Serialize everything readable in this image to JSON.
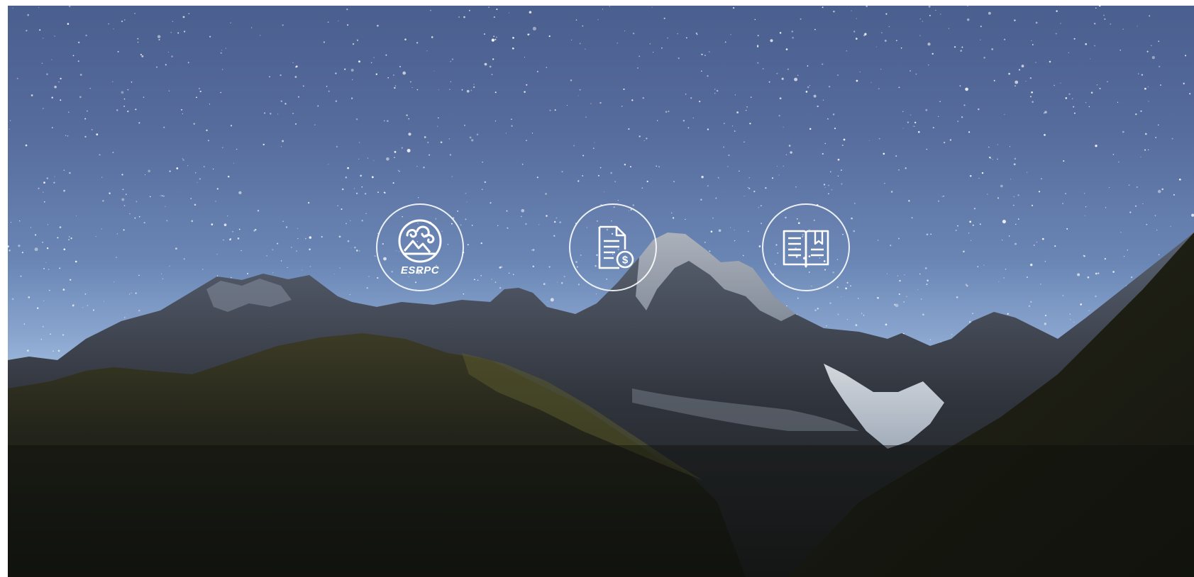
{
  "hero": {
    "background": "starry-night-mountains",
    "links": [
      {
        "name": "esrpc-logo-link",
        "icon": "esrpc-logo",
        "label": "ESRPC"
      },
      {
        "name": "invoice-link",
        "icon": "document-dollar-icon"
      },
      {
        "name": "book-link",
        "icon": "open-book-icon"
      }
    ]
  },
  "colors": {
    "sky_top": "#4a5f8e",
    "sky_horizon": "#9fb9dd",
    "mountain_dark": "#1c1c18",
    "snow": "#dfe6ee",
    "ring": "#ffffff"
  }
}
